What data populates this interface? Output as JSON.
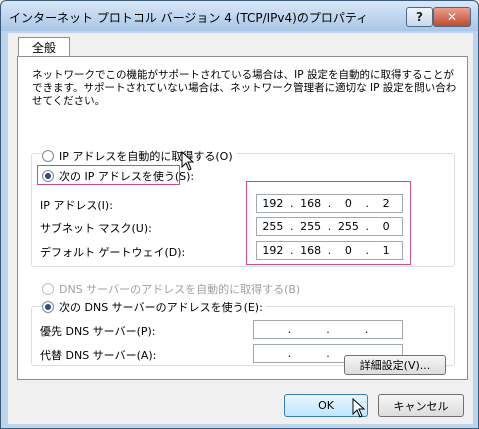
{
  "window": {
    "title": "インターネット プロトコル バージョン 4 (TCP/IPv4)のプロパティ",
    "help_label": "?",
    "close_label": "✕"
  },
  "tabs": [
    {
      "label": "全般"
    }
  ],
  "description": "ネットワークでこの機能がサポートされている場合は、IP 設定を自動的に取得することができます。サポートされていない場合は、ネットワーク管理者に適切な IP 設定を問い合わせてください。",
  "ip_section": {
    "auto_label": "IP アドレスを自動的に取得する(O)",
    "manual_label": "次の IP アドレスを使う(S):",
    "ip_label": "IP アドレス(I):",
    "subnet_label": "サブネット マスク(U):",
    "gateway_label": "デフォルト ゲートウェイ(D):",
    "ip": [
      "192",
      "168",
      "0",
      "2"
    ],
    "subnet": [
      "255",
      "255",
      "255",
      "0"
    ],
    "gateway": [
      "192",
      "168",
      "0",
      "1"
    ]
  },
  "dns_section": {
    "auto_label": "DNS サーバーのアドレスを自動的に取得する(B)",
    "manual_label": "次の DNS サーバーのアドレスを使う(E):",
    "preferred_label": "優先 DNS サーバー(P):",
    "alternate_label": "代替 DNS サーバー(A):",
    "preferred": [
      "",
      "",
      "",
      ""
    ],
    "alternate": [
      "",
      "",
      "",
      ""
    ]
  },
  "buttons": {
    "advanced": "詳細設定(V)...",
    "ok": "OK",
    "cancel": "キャンセル"
  },
  "colors": {
    "highlight": "#d04a8a",
    "selected_radio": "#2e4a8c"
  }
}
